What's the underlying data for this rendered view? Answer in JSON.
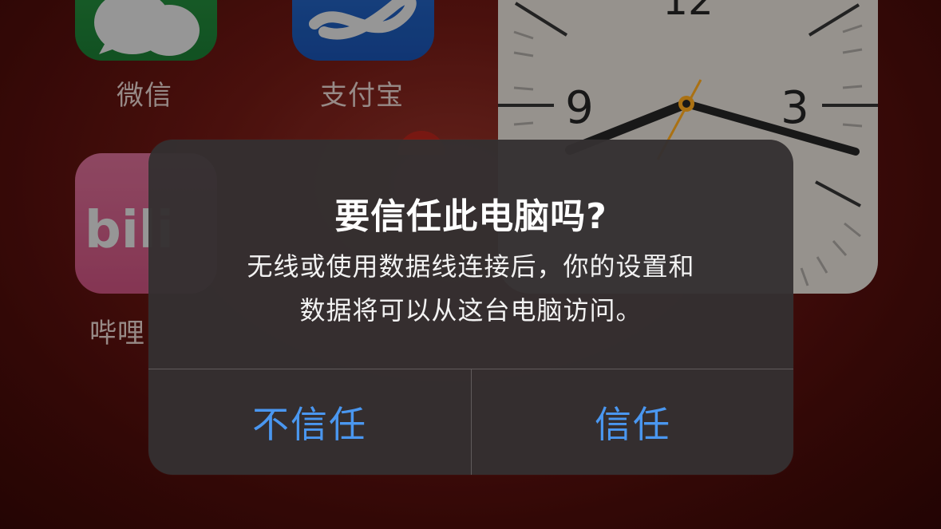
{
  "home_screen": {
    "apps": [
      {
        "label": "微信",
        "icon": "wechat-icon"
      },
      {
        "label": "支付宝",
        "icon": "alipay-icon"
      },
      {
        "label": "哔哩",
        "icon": "bilibili-icon"
      }
    ],
    "clock_widget": {
      "numerals": [
        "12",
        "9",
        "3"
      ]
    }
  },
  "alert": {
    "title": "要信任此电脑吗?",
    "message_line1": "无线或使用数据线连接后，你的设置和",
    "message_line2": "数据将可以从这台电脑访问。",
    "buttons": {
      "dont_trust": "不信任",
      "trust": "信任"
    }
  },
  "colors": {
    "button_text": "#4a97f0",
    "alert_background": "#343031"
  }
}
